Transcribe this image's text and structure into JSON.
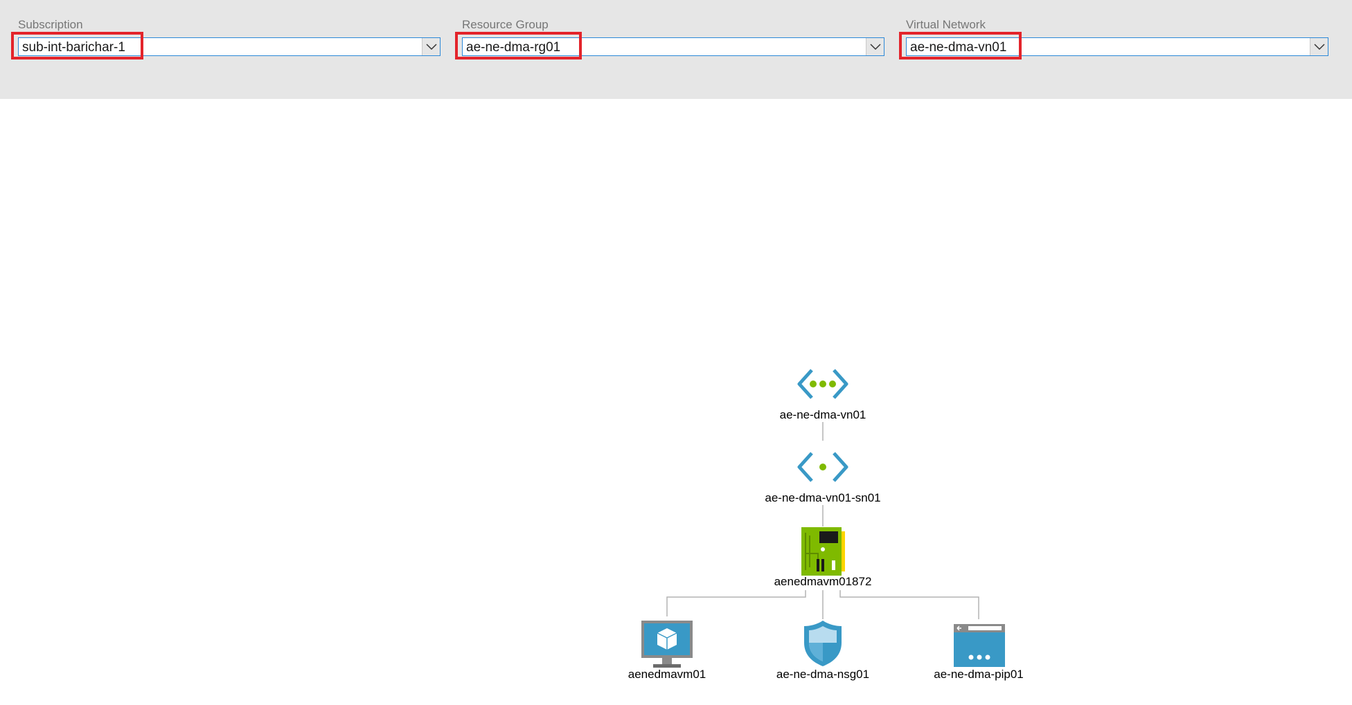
{
  "filters": {
    "subscription": {
      "label": "Subscription",
      "value": "sub-int-barichar-1"
    },
    "resource_group": {
      "label": "Resource Group",
      "value": "ae-ne-dma-rg01"
    },
    "virtual_network": {
      "label": "Virtual Network",
      "value": "ae-ne-dma-vn01"
    }
  },
  "topology": {
    "vnet": {
      "name": "ae-ne-dma-vn01",
      "icon": "virtual-network-icon"
    },
    "subnet": {
      "name": "ae-ne-dma-vn01-sn01",
      "icon": "subnet-icon"
    },
    "nic": {
      "name": "aenedmavm01872",
      "icon": "network-interface-icon"
    },
    "vm": {
      "name": "aenedmavm01",
      "icon": "virtual-machine-icon"
    },
    "nsg": {
      "name": "ae-ne-dma-nsg01",
      "icon": "network-security-group-icon"
    },
    "pip": {
      "name": "ae-ne-dma-pip01",
      "icon": "public-ip-icon"
    }
  },
  "colors": {
    "highlight": "#e3242b",
    "accent_blue": "#3999c6",
    "accent_green": "#7fba00",
    "filter_background": "#e6e6e6"
  }
}
